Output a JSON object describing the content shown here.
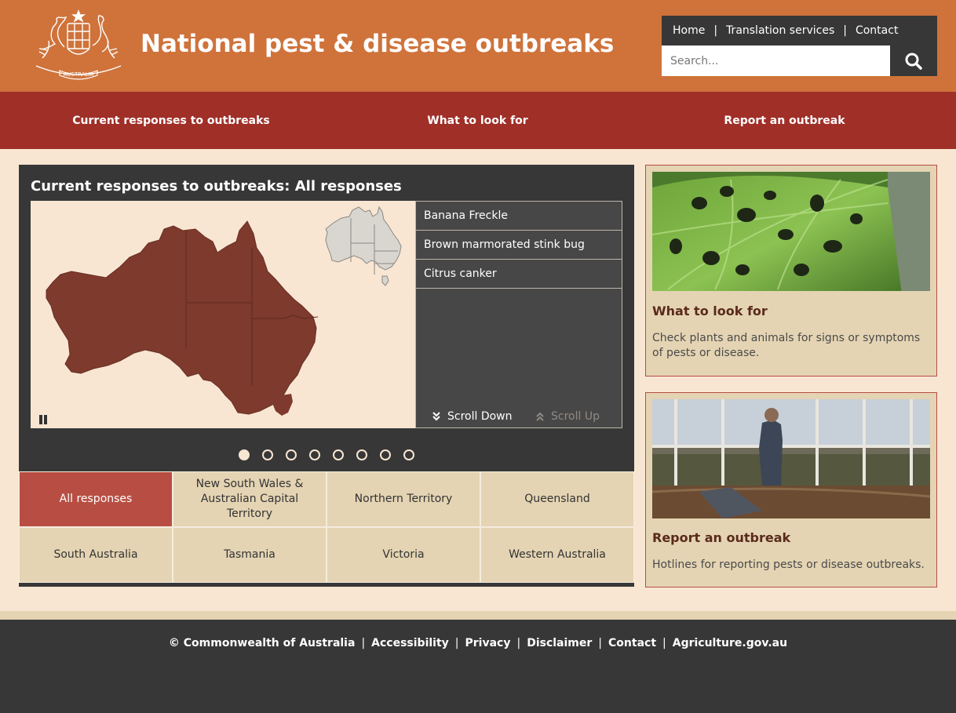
{
  "header": {
    "title": "National pest & disease outbreaks",
    "crest_text": "AUSTRALIA",
    "utility_links": [
      "Home",
      "Translation services",
      "Contact"
    ],
    "search_placeholder": "Search..."
  },
  "main_nav": [
    "Current responses to outbreaks",
    "What to look for",
    "Report an outbreak"
  ],
  "responses_panel": {
    "title": "Current responses to outbreaks: All responses",
    "outbreaks": [
      "Banana Freckle",
      "Brown marmorated stink bug",
      "Citrus canker"
    ],
    "scroll_down": "Scroll Down",
    "scroll_up": "Scroll Up",
    "slide_count": 8,
    "active_slide": 1,
    "regions": [
      "All responses",
      "New South Wales & Australian Capital Territory",
      "Northern Territory",
      "Queensland",
      "South Australia",
      "Tasmania",
      "Victoria",
      "Western Australia"
    ],
    "active_region": "All responses"
  },
  "sidebar": {
    "cards": [
      {
        "title": "What to look for",
        "text": "Check plants and animals for signs or symptoms of pests or disease."
      },
      {
        "title": "Report an outbreak",
        "text": "Hotlines for reporting pests or disease outbreaks."
      }
    ]
  },
  "footer": {
    "links": [
      "© Commonwealth of Australia",
      "Accessibility",
      "Privacy",
      "Disclaimer",
      "Contact",
      "Agriculture.gov.au"
    ]
  },
  "colors": {
    "header": "#cf733b",
    "nav": "#a02f28",
    "page_bg": "#f8e6d3",
    "panel": "#373737",
    "region_active": "#b84e43",
    "region_tile": "#e4d4b3",
    "map_fill": "#7d3a2d"
  }
}
